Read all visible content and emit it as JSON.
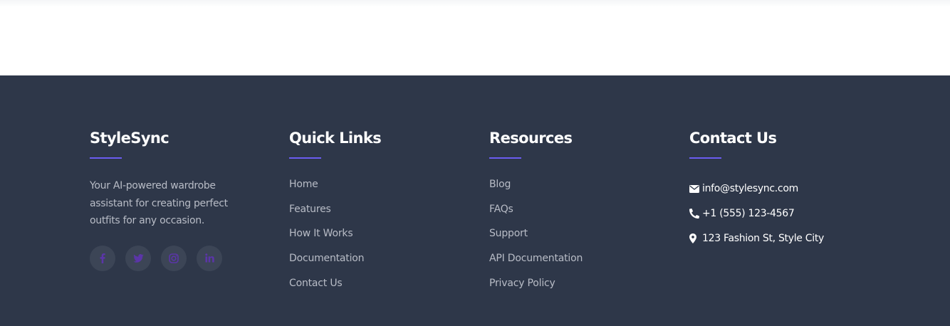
{
  "brand": {
    "name": "StyleSync",
    "description": "Your AI-powered wardrobe assistant for creating perfect outfits for any occasion."
  },
  "social": [
    {
      "icon": "facebook-icon"
    },
    {
      "icon": "twitter-icon"
    },
    {
      "icon": "instagram-icon"
    },
    {
      "icon": "linkedin-icon"
    }
  ],
  "quick_links": {
    "title": "Quick Links",
    "items": [
      "Home",
      "Features",
      "How It Works",
      "Documentation",
      "Contact Us"
    ]
  },
  "resources": {
    "title": "Resources",
    "items": [
      "Blog",
      "FAQs",
      "Support",
      "API Documentation",
      "Privacy Policy"
    ]
  },
  "contact": {
    "title": "Contact Us",
    "email": "info@stylesync.com",
    "phone": "+1 (555) 123-4567",
    "address": "123 Fashion St, Style City"
  },
  "colors": {
    "footer_bg": "#2e3749",
    "accent": "#6b5cf0",
    "muted_text": "#b8bcc6",
    "social_bg": "#3c4556",
    "social_icon": "#5b35a8"
  }
}
